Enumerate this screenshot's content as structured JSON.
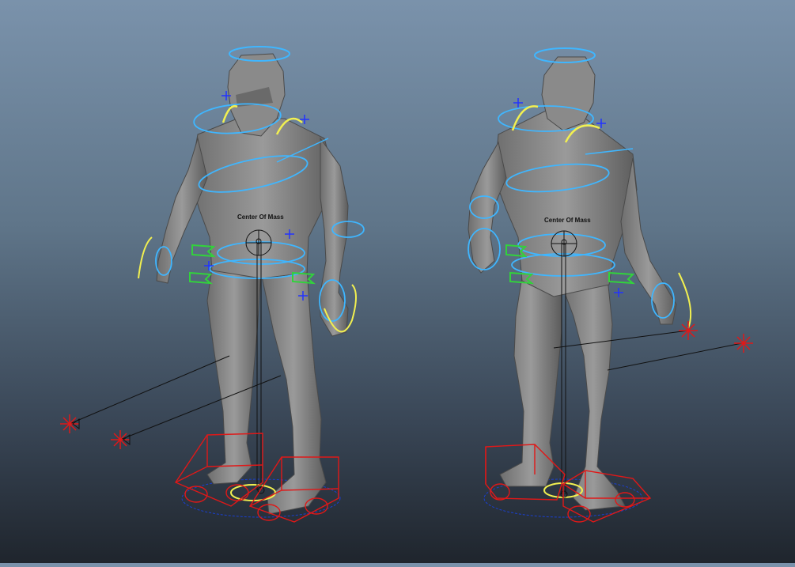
{
  "viewport": {
    "label_front": "Center Of Mass",
    "label_back": "Center Of Mass"
  },
  "colors": {
    "mesh": "#8f8f8f",
    "mesh_dark": "#5a5a5a",
    "control_blue": "#3fb6ff",
    "control_yellow": "#f2f050",
    "control_green": "#32d23c",
    "control_red": "#e01818",
    "locator_blue": "#2233ff",
    "line_black": "#111111"
  },
  "icons": [
    "locator-star-icon",
    "ik-handle-icon",
    "center-of-mass-icon"
  ]
}
